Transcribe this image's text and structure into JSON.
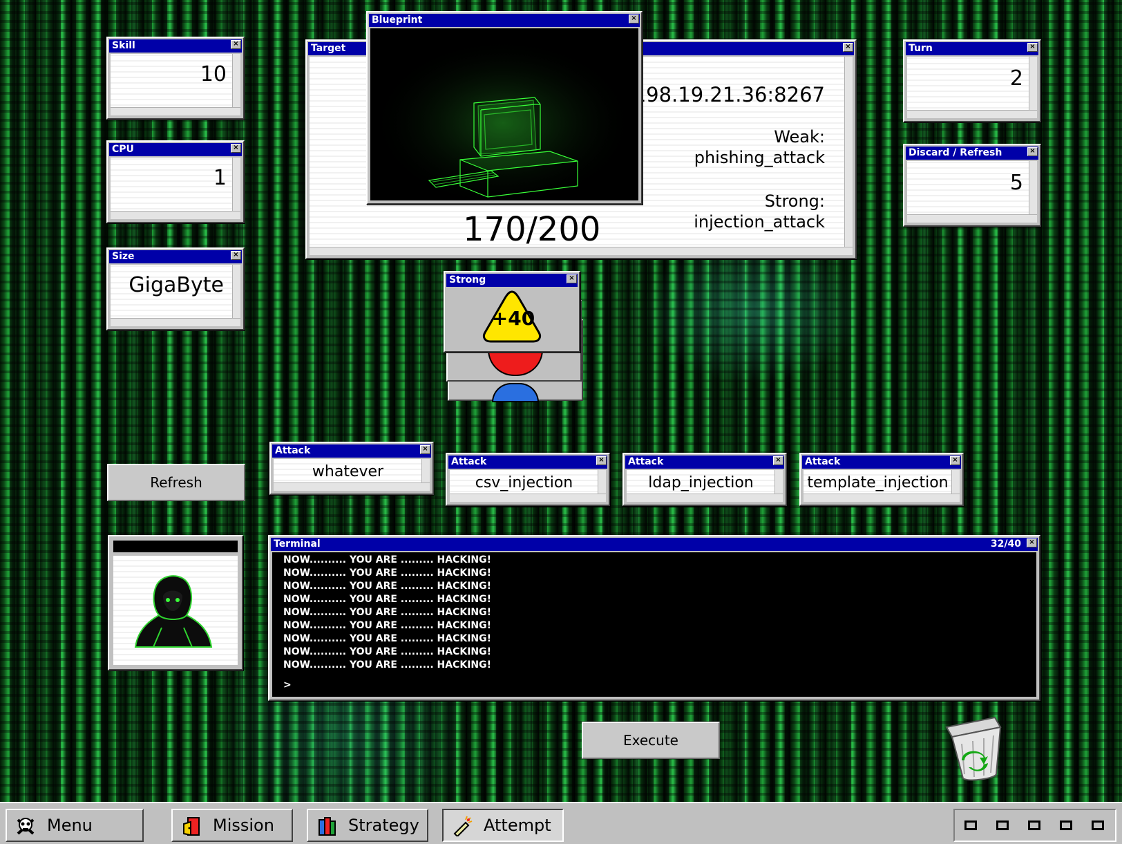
{
  "stats": {
    "skill": {
      "title": "Skill",
      "value": "10"
    },
    "cpu": {
      "title": "CPU",
      "value": "1"
    },
    "size": {
      "title": "Size",
      "value": "GigaByte"
    },
    "turn": {
      "title": "Turn",
      "value": "2"
    },
    "discard": {
      "title": "Discard / Refresh",
      "value": "5"
    }
  },
  "target": {
    "title": "Target",
    "address": "198.19.21.36:8267",
    "weak_label": "Weak:",
    "weak_value": "phishing_attack",
    "strong_label": "Strong:",
    "strong_value": "injection_attack",
    "health": "170/200"
  },
  "blueprint": {
    "title": "Blueprint"
  },
  "strong_card": {
    "title": "Strong",
    "badge": "+40",
    "badge_color": "#ffe600"
  },
  "attacks": [
    {
      "title": "Attack",
      "name": "whatever"
    },
    {
      "title": "Attack",
      "name": "csv_injection"
    },
    {
      "title": "Attack",
      "name": "ldap_injection"
    },
    {
      "title": "Attack",
      "name": "template_injection"
    }
  ],
  "refresh_button": "Refresh",
  "execute_button": "Execute",
  "terminal": {
    "title": "Terminal",
    "counter": "32/40",
    "lines": [
      "NOW.......... YOU ARE ......... HACKING!",
      "NOW.......... YOU ARE ......... HACKING!",
      "NOW.......... YOU ARE ......... HACKING!",
      "NOW.......... YOU ARE ......... HACKING!",
      "NOW.......... YOU ARE ......... HACKING!",
      "NOW.......... YOU ARE ......... HACKING!",
      "NOW.......... YOU ARE ......... HACKING!",
      "NOW.......... YOU ARE ......... HACKING!",
      "NOW.......... YOU ARE ......... HACKING!"
    ],
    "prompt": ">"
  },
  "taskbar": {
    "items": [
      {
        "label": "Menu",
        "icon": "skull-icon"
      },
      {
        "label": "Mission",
        "icon": "door-icon"
      },
      {
        "label": "Strategy",
        "icon": "book-icon"
      },
      {
        "label": "Attempt",
        "icon": "firecracker-icon"
      }
    ]
  },
  "colors": {
    "titlebar": "#0000a8",
    "matrix_green": "#1fa238"
  }
}
